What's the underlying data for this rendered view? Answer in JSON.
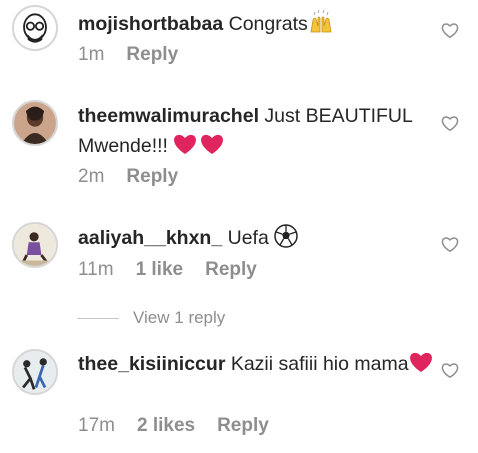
{
  "comments": [
    {
      "username": "mojishortbabaa",
      "text": "Congrats",
      "emoji": "raised-hands",
      "time": "1m",
      "likes": "",
      "reply": "Reply"
    },
    {
      "username": "theemwalimurachel",
      "text": "Just BEAUTIFUL Mwende!!!",
      "emoji": "red-hearts",
      "time": "2m",
      "likes": "",
      "reply": "Reply"
    },
    {
      "username": "aaliyah__khxn_",
      "text": "Uefa",
      "emoji": "soccer-ball",
      "time": "11m",
      "likes": "1 like",
      "reply": "Reply"
    },
    {
      "username": "thee_kisiiniccur",
      "text": "Kazii safiii hio mama",
      "emoji": "red-heart",
      "time": "17m",
      "likes": "2 likes",
      "reply": "Reply"
    }
  ],
  "view_replies": "View 1 reply",
  "colors": {
    "text": "#262626",
    "muted": "#8e8e8e",
    "heart_emoji": "#e0245e"
  }
}
